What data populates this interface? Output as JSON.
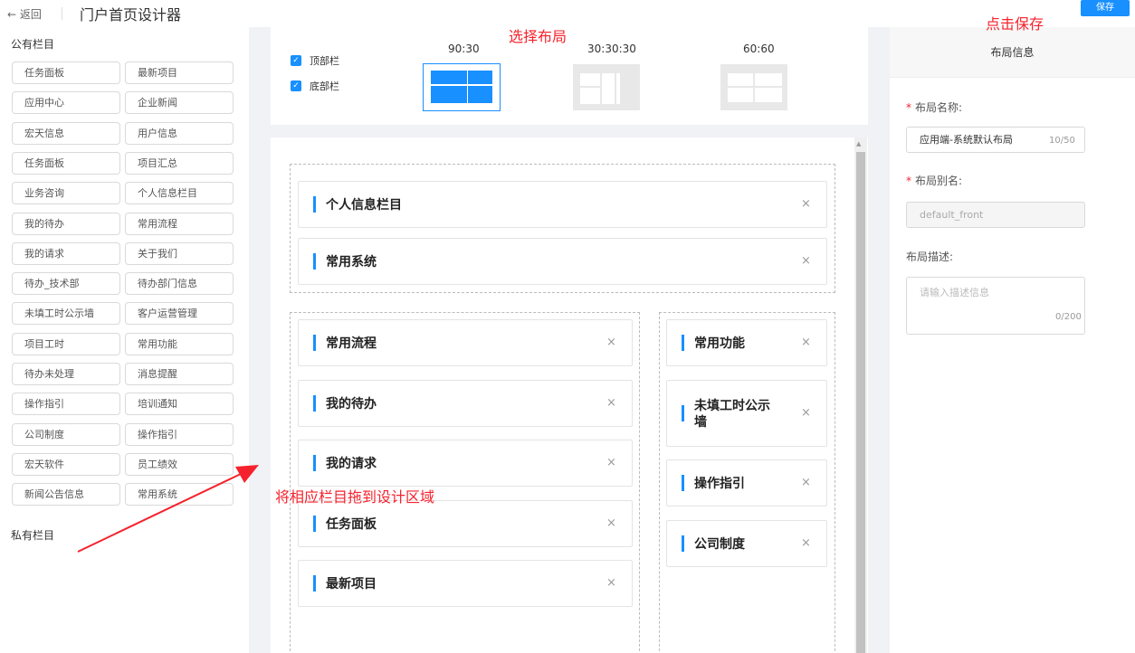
{
  "header": {
    "back_label": "← 返回",
    "title": "门户首页设计器",
    "save_label": "保存"
  },
  "sidebar": {
    "public_title": "公有栏目",
    "private_title": "私有栏目",
    "items_left": [
      "任务面板",
      "应用中心",
      "宏天信息",
      "任务面板",
      "业务咨询",
      "我的待办",
      "我的请求",
      "待办_技术部",
      "未填工时公示墙",
      "项目工时",
      "待办未处理",
      "操作指引",
      "公司制度",
      "宏天软件",
      "新闻公告信息"
    ],
    "items_right": [
      "最新项目",
      "企业新闻",
      "用户信息",
      "项目汇总",
      "个人信息栏目",
      "常用流程",
      "关于我们",
      "待办部门信息",
      "客户运营管理",
      "常用功能",
      "消息提醒",
      "培训通知",
      "操作指引",
      "员工绩效",
      "常用系统"
    ]
  },
  "layout": {
    "checkboxes": [
      {
        "label": "顶部栏",
        "checked": true
      },
      {
        "label": "底部栏",
        "checked": true
      }
    ],
    "options": [
      "90:30",
      "30:30:30",
      "60:60"
    ],
    "selected": "90:30"
  },
  "design": {
    "top_cards": [
      "个人信息栏目",
      "常用系统"
    ],
    "left_cards": [
      "常用流程",
      "我的待办",
      "我的请求",
      "任务面板",
      "最新项目"
    ],
    "right_cards": [
      "常用功能",
      "未填工时公示墙",
      "操作指引",
      "公司制度"
    ],
    "close_glyph": "×"
  },
  "right_panel": {
    "header": "布局信息",
    "name_label": "布局名称:",
    "name_value": "应用端-系统默认布局",
    "name_counter": "10/50",
    "alias_label": "布局别名:",
    "alias_value": "default_front",
    "desc_label": "布局描述:",
    "desc_placeholder": "请输入描述信息",
    "desc_counter": "0/200"
  },
  "annotations": {
    "select_layout": "选择布局",
    "click_save": "点击保存",
    "drag_hint": "将相应栏目拖到设计区域"
  },
  "colors": {
    "accent": "#1890ff",
    "annotation": "#f5222d",
    "thumb_inactive": "#e8e8e8"
  }
}
